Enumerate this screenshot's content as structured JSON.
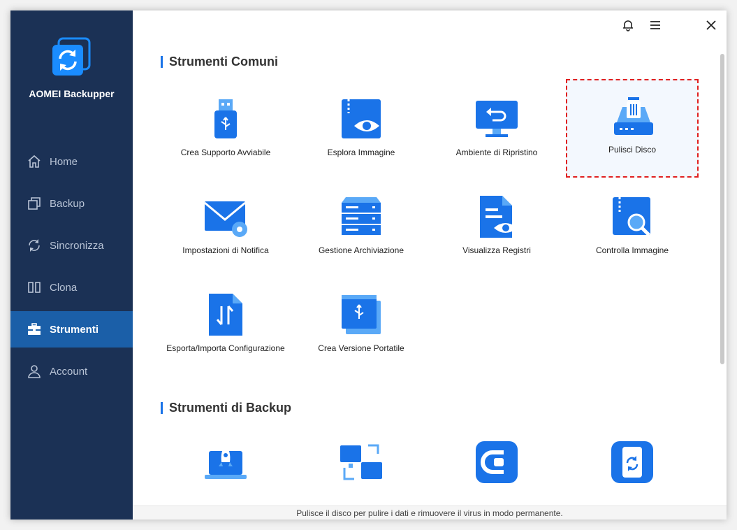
{
  "app": {
    "name": "AOMEI Backupper"
  },
  "nav": [
    {
      "label": "Home",
      "icon": "home-icon"
    },
    {
      "label": "Backup",
      "icon": "backup-icon"
    },
    {
      "label": "Sincronizza",
      "icon": "sync-icon"
    },
    {
      "label": "Clona",
      "icon": "clone-icon"
    },
    {
      "label": "Strumenti",
      "icon": "tools-icon",
      "active": true
    },
    {
      "label": "Account",
      "icon": "account-icon"
    }
  ],
  "sections": {
    "common": {
      "title": "Strumenti Comuni",
      "tools": [
        {
          "label": "Crea Supporto Avviabile",
          "icon": "usb-drive-icon"
        },
        {
          "label": "Esplora Immagine",
          "icon": "explore-image-icon"
        },
        {
          "label": "Ambiente di Ripristino",
          "icon": "recovery-environment-icon"
        },
        {
          "label": "Pulisci Disco",
          "icon": "wipe-disk-icon",
          "selected": true
        },
        {
          "label": "Impostazioni di Notifica",
          "icon": "notification-settings-icon"
        },
        {
          "label": "Gestione Archiviazione",
          "icon": "storage-management-icon"
        },
        {
          "label": "Visualizza Registri",
          "icon": "view-logs-icon"
        },
        {
          "label": "Controlla Immagine",
          "icon": "check-image-icon"
        },
        {
          "label": "Esporta/Importa Configurazione",
          "icon": "export-import-icon"
        },
        {
          "label": "Crea Versione Portatile",
          "icon": "portable-version-icon"
        }
      ]
    },
    "backup": {
      "title": "Strumenti di Backup",
      "tools": [
        {
          "icon": "pxe-boot-icon"
        },
        {
          "icon": "image-deploy-icon"
        },
        {
          "icon": "cbackup-icon"
        },
        {
          "icon": "phone-backup-icon"
        }
      ]
    }
  },
  "status": {
    "text": "Pulisce il disco per pulire i dati e rimuovere il virus in modo permanente."
  },
  "colors": {
    "sidebar": "#1b3155",
    "active_nav": "#1b5fa8",
    "accent": "#1a73e8",
    "selection_border": "#e02020"
  }
}
